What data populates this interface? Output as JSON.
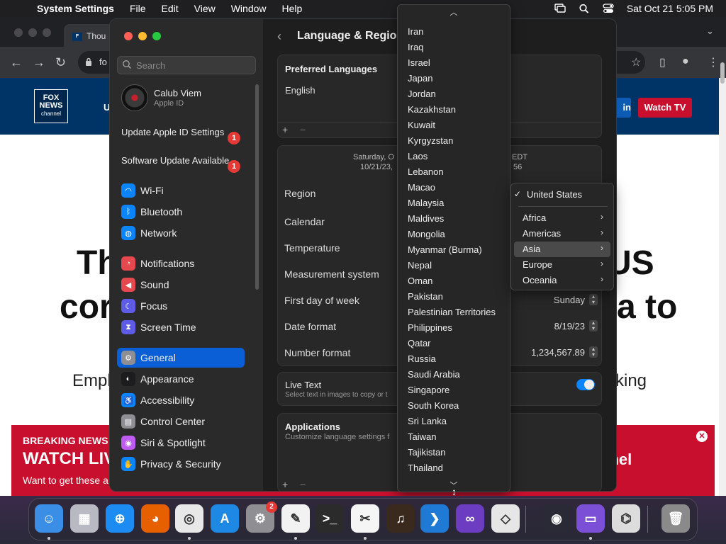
{
  "menubar": {
    "app_name": "System Settings",
    "items": [
      "File",
      "Edit",
      "View",
      "Window",
      "Help"
    ],
    "datetime": "Sat Oct 21  5:05 PM"
  },
  "browser": {
    "tab_title": "Thou",
    "url_fragment": "fo",
    "fox": {
      "logo_text": "FOX NEWS",
      "logo_sub": "channel",
      "nav_fragment": "U",
      "signin_fragment": "in",
      "watch_tv": "Watch TV"
    },
    "hero": {
      "line1_left": "Th",
      "line1_right": "US",
      "line2_left": "cor",
      "line2_right": "a to",
      "sub_left": "Empl",
      "sub_right": "rking"
    },
    "breaking": {
      "label": "BREAKING NEWS",
      "title": "WATCH LIV",
      "sub": "Want to get these a",
      "right": "nnel",
      "close": "✕"
    }
  },
  "settings": {
    "search_placeholder": "Search",
    "user": {
      "name": "Calub Viem",
      "subtitle": "Apple ID"
    },
    "notices": [
      {
        "label": "Update Apple ID Settings",
        "badge": "1"
      },
      {
        "label": "Software Update Available",
        "badge": "1"
      }
    ],
    "sidebar_items": [
      {
        "label": "Wi-Fi",
        "color": "#0a84ff",
        "icon": "wifi-icon",
        "glyph": "◠"
      },
      {
        "label": "Bluetooth",
        "color": "#0a84ff",
        "icon": "bluetooth-icon",
        "glyph": "ᛒ"
      },
      {
        "label": "Network",
        "color": "#0a84ff",
        "icon": "globe-icon",
        "glyph": "◍"
      },
      {
        "label": "Notifications",
        "color": "#e5484d",
        "icon": "bell-icon",
        "glyph": "◔"
      },
      {
        "label": "Sound",
        "color": "#e5484d",
        "icon": "speaker-icon",
        "glyph": "◀"
      },
      {
        "label": "Focus",
        "color": "#5e5ce6",
        "icon": "moon-icon",
        "glyph": "☾"
      },
      {
        "label": "Screen Time",
        "color": "#5e5ce6",
        "icon": "hourglass-icon",
        "glyph": "⧗"
      },
      {
        "label": "General",
        "color": "#8e8e93",
        "icon": "gear-icon",
        "glyph": "⚙"
      },
      {
        "label": "Appearance",
        "color": "#1c1c1e",
        "icon": "appearance-icon",
        "glyph": "◐"
      },
      {
        "label": "Accessibility",
        "color": "#0a84ff",
        "icon": "accessibility-icon",
        "glyph": "♿"
      },
      {
        "label": "Control Center",
        "color": "#8e8e93",
        "icon": "control-center-icon",
        "glyph": "▤"
      },
      {
        "label": "Siri & Spotlight",
        "color": "#bf5af2",
        "icon": "siri-icon",
        "glyph": "◉"
      },
      {
        "label": "Privacy & Security",
        "color": "#0a84ff",
        "icon": "hand-icon",
        "glyph": "✋"
      }
    ],
    "content": {
      "title": "Language & Region",
      "preferred_languages_title": "Preferred Languages",
      "languages": [
        "English"
      ],
      "add": "+",
      "remove": "−",
      "date_preview_l1": "Saturday, O",
      "date_preview_l1b": "EDT",
      "date_preview_l2": "10/21/23,",
      "date_preview_l2b": "56",
      "rows": [
        {
          "label": "Region",
          "value": ""
        },
        {
          "label": "Calendar",
          "value": ""
        },
        {
          "label": "Temperature",
          "value": ""
        },
        {
          "label": "Measurement system",
          "value": ""
        },
        {
          "label": "First day of week",
          "value": "Sunday"
        },
        {
          "label": "Date format",
          "value": "8/19/23"
        },
        {
          "label": "Number format",
          "value": "1,234,567.89"
        }
      ],
      "live_text_title": "Live Text",
      "live_text_sub": "Select text in images to copy or t",
      "live_text_on": true,
      "applications_title": "Applications",
      "applications_sub": "Customize language settings f"
    },
    "countries": [
      "Iran",
      "Iraq",
      "Israel",
      "Japan",
      "Jordan",
      "Kazakhstan",
      "Kuwait",
      "Kyrgyzstan",
      "Laos",
      "Lebanon",
      "Macao",
      "Malaysia",
      "Maldives",
      "Mongolia",
      "Myanmar (Burma)",
      "Nepal",
      "Oman",
      "Pakistan",
      "Palestinian Territories",
      "Philippines",
      "Qatar",
      "Russia",
      "Saudi Arabia",
      "Singapore",
      "South Korea",
      "Sri Lanka",
      "Taiwan",
      "Tajikistan",
      "Thailand"
    ],
    "region_menu": {
      "selected": "United States",
      "continents": [
        "Africa",
        "Americas",
        "Asia",
        "Europe",
        "Oceania"
      ],
      "highlighted": "Asia"
    }
  },
  "dock": {
    "apps": [
      {
        "name": "Finder",
        "icon": "finder-icon",
        "color": "#3a8ee6",
        "glyph": "☺"
      },
      {
        "name": "Launchpad",
        "icon": "launchpad-icon",
        "color": "#b9b9c4",
        "glyph": "▦"
      },
      {
        "name": "Safari",
        "icon": "safari-icon",
        "color": "#1d8cf2",
        "glyph": "⊕"
      },
      {
        "name": "Firefox",
        "icon": "firefox-icon",
        "color": "#e66000",
        "glyph": "◕"
      },
      {
        "name": "Chrome",
        "icon": "chrome-icon",
        "color": "#e8e8e8",
        "glyph": "◎"
      },
      {
        "name": "App Store",
        "icon": "app-store-icon",
        "color": "#1e88e5",
        "glyph": "A"
      },
      {
        "name": "System Settings",
        "icon": "system-settings-icon",
        "color": "#8e8e93",
        "glyph": "⚙",
        "badge": "2"
      },
      {
        "name": "TextEdit",
        "icon": "textedit-icon",
        "color": "#f2f2f2",
        "glyph": "✎"
      },
      {
        "name": "Terminal",
        "icon": "terminal-icon",
        "color": "#2b2b2b",
        "glyph": ">_"
      },
      {
        "name": "CapCut",
        "icon": "capcut-icon",
        "color": "#f5f5f5",
        "glyph": "✂"
      },
      {
        "name": "GarageBand",
        "icon": "garageband-icon",
        "color": "#3a2a1e",
        "glyph": "♫"
      },
      {
        "name": "Visual Studio Code",
        "icon": "vscode-icon",
        "color": "#1f7ad6",
        "glyph": "❯"
      },
      {
        "name": "Visual Studio",
        "icon": "visual-studio-icon",
        "color": "#6c3cc1",
        "glyph": "∞"
      },
      {
        "name": "Roblox",
        "icon": "roblox-icon",
        "color": "#e6e6e6",
        "glyph": "◇"
      },
      {
        "name": "OBS",
        "icon": "obs-icon",
        "color": "#2a2a36",
        "glyph": "◉"
      },
      {
        "name": "Podcasts",
        "icon": "app-icon",
        "color": "#7b4fd6",
        "glyph": "▭"
      },
      {
        "name": "Archive Utility",
        "icon": "archive-utility-icon",
        "color": "#dcdcdc",
        "glyph": "⌬"
      },
      {
        "name": "Trash",
        "icon": "trash-icon",
        "color": "#8a8a8a",
        "glyph": "🗑"
      }
    ]
  }
}
